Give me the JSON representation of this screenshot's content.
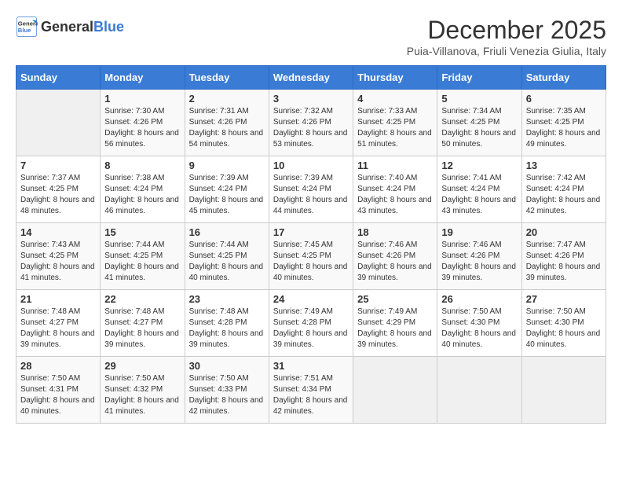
{
  "header": {
    "logo_general": "General",
    "logo_blue": "Blue",
    "month": "December 2025",
    "location": "Puia-Villanova, Friuli Venezia Giulia, Italy"
  },
  "days_of_week": [
    "Sunday",
    "Monday",
    "Tuesday",
    "Wednesday",
    "Thursday",
    "Friday",
    "Saturday"
  ],
  "weeks": [
    [
      {
        "day": "",
        "empty": true
      },
      {
        "day": "1",
        "sunrise": "7:30 AM",
        "sunset": "4:26 PM",
        "daylight": "8 hours and 56 minutes."
      },
      {
        "day": "2",
        "sunrise": "7:31 AM",
        "sunset": "4:26 PM",
        "daylight": "8 hours and 54 minutes."
      },
      {
        "day": "3",
        "sunrise": "7:32 AM",
        "sunset": "4:26 PM",
        "daylight": "8 hours and 53 minutes."
      },
      {
        "day": "4",
        "sunrise": "7:33 AM",
        "sunset": "4:25 PM",
        "daylight": "8 hours and 51 minutes."
      },
      {
        "day": "5",
        "sunrise": "7:34 AM",
        "sunset": "4:25 PM",
        "daylight": "8 hours and 50 minutes."
      },
      {
        "day": "6",
        "sunrise": "7:35 AM",
        "sunset": "4:25 PM",
        "daylight": "8 hours and 49 minutes."
      }
    ],
    [
      {
        "day": "7",
        "sunrise": "7:37 AM",
        "sunset": "4:25 PM",
        "daylight": "8 hours and 48 minutes."
      },
      {
        "day": "8",
        "sunrise": "7:38 AM",
        "sunset": "4:24 PM",
        "daylight": "8 hours and 46 minutes."
      },
      {
        "day": "9",
        "sunrise": "7:39 AM",
        "sunset": "4:24 PM",
        "daylight": "8 hours and 45 minutes."
      },
      {
        "day": "10",
        "sunrise": "7:39 AM",
        "sunset": "4:24 PM",
        "daylight": "8 hours and 44 minutes."
      },
      {
        "day": "11",
        "sunrise": "7:40 AM",
        "sunset": "4:24 PM",
        "daylight": "8 hours and 43 minutes."
      },
      {
        "day": "12",
        "sunrise": "7:41 AM",
        "sunset": "4:24 PM",
        "daylight": "8 hours and 43 minutes."
      },
      {
        "day": "13",
        "sunrise": "7:42 AM",
        "sunset": "4:24 PM",
        "daylight": "8 hours and 42 minutes."
      }
    ],
    [
      {
        "day": "14",
        "sunrise": "7:43 AM",
        "sunset": "4:25 PM",
        "daylight": "8 hours and 41 minutes."
      },
      {
        "day": "15",
        "sunrise": "7:44 AM",
        "sunset": "4:25 PM",
        "daylight": "8 hours and 41 minutes."
      },
      {
        "day": "16",
        "sunrise": "7:44 AM",
        "sunset": "4:25 PM",
        "daylight": "8 hours and 40 minutes."
      },
      {
        "day": "17",
        "sunrise": "7:45 AM",
        "sunset": "4:25 PM",
        "daylight": "8 hours and 40 minutes."
      },
      {
        "day": "18",
        "sunrise": "7:46 AM",
        "sunset": "4:26 PM",
        "daylight": "8 hours and 39 minutes."
      },
      {
        "day": "19",
        "sunrise": "7:46 AM",
        "sunset": "4:26 PM",
        "daylight": "8 hours and 39 minutes."
      },
      {
        "day": "20",
        "sunrise": "7:47 AM",
        "sunset": "4:26 PM",
        "daylight": "8 hours and 39 minutes."
      }
    ],
    [
      {
        "day": "21",
        "sunrise": "7:48 AM",
        "sunset": "4:27 PM",
        "daylight": "8 hours and 39 minutes."
      },
      {
        "day": "22",
        "sunrise": "7:48 AM",
        "sunset": "4:27 PM",
        "daylight": "8 hours and 39 minutes."
      },
      {
        "day": "23",
        "sunrise": "7:48 AM",
        "sunset": "4:28 PM",
        "daylight": "8 hours and 39 minutes."
      },
      {
        "day": "24",
        "sunrise": "7:49 AM",
        "sunset": "4:28 PM",
        "daylight": "8 hours and 39 minutes."
      },
      {
        "day": "25",
        "sunrise": "7:49 AM",
        "sunset": "4:29 PM",
        "daylight": "8 hours and 39 minutes."
      },
      {
        "day": "26",
        "sunrise": "7:50 AM",
        "sunset": "4:30 PM",
        "daylight": "8 hours and 40 minutes."
      },
      {
        "day": "27",
        "sunrise": "7:50 AM",
        "sunset": "4:30 PM",
        "daylight": "8 hours and 40 minutes."
      }
    ],
    [
      {
        "day": "28",
        "sunrise": "7:50 AM",
        "sunset": "4:31 PM",
        "daylight": "8 hours and 40 minutes."
      },
      {
        "day": "29",
        "sunrise": "7:50 AM",
        "sunset": "4:32 PM",
        "daylight": "8 hours and 41 minutes."
      },
      {
        "day": "30",
        "sunrise": "7:50 AM",
        "sunset": "4:33 PM",
        "daylight": "8 hours and 42 minutes."
      },
      {
        "day": "31",
        "sunrise": "7:51 AM",
        "sunset": "4:34 PM",
        "daylight": "8 hours and 42 minutes."
      },
      {
        "day": "",
        "empty": true
      },
      {
        "day": "",
        "empty": true
      },
      {
        "day": "",
        "empty": true
      }
    ]
  ]
}
